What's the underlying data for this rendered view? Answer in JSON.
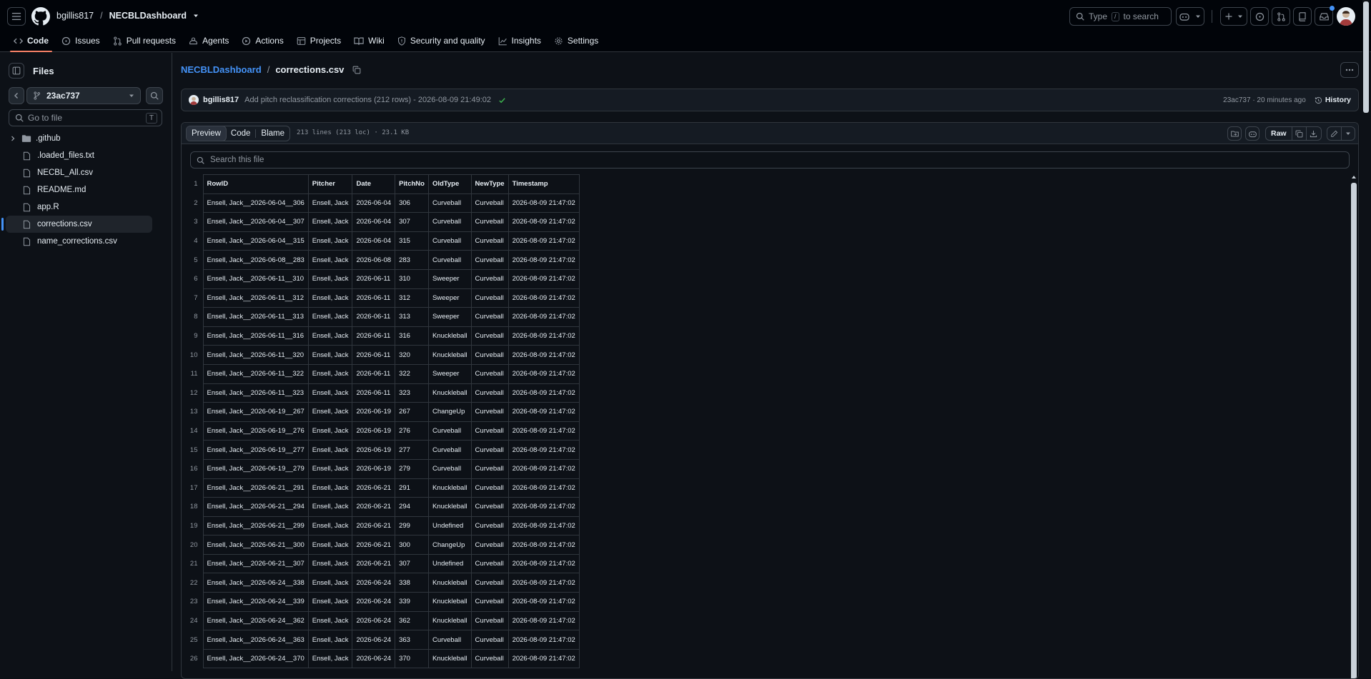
{
  "header": {
    "owner": "bgillis817",
    "separator": "/",
    "repo": "NECBLDashboard",
    "search": {
      "prefix": "Type",
      "key": "/",
      "suffix": "to search"
    }
  },
  "nav": {
    "tabs": [
      {
        "label": "Code",
        "icon": "code-icon"
      },
      {
        "label": "Issues",
        "icon": "issue-icon"
      },
      {
        "label": "Pull requests",
        "icon": "pull-request-icon"
      },
      {
        "label": "Agents",
        "icon": "agent-icon"
      },
      {
        "label": "Actions",
        "icon": "play-icon"
      },
      {
        "label": "Projects",
        "icon": "table-icon"
      },
      {
        "label": "Wiki",
        "icon": "book-icon"
      },
      {
        "label": "Security and quality",
        "icon": "shield-icon"
      },
      {
        "label": "Insights",
        "icon": "graph-icon"
      },
      {
        "label": "Settings",
        "icon": "gear-icon"
      }
    ]
  },
  "sidebar": {
    "title": "Files",
    "branch": "23ac737",
    "goto_placeholder": "Go to file",
    "goto_key": "T",
    "items": [
      {
        "label": ".github",
        "type": "folder"
      },
      {
        "label": ".loaded_files.txt",
        "type": "file"
      },
      {
        "label": "NECBL_All.csv",
        "type": "file"
      },
      {
        "label": "README.md",
        "type": "file"
      },
      {
        "label": "app.R",
        "type": "file"
      },
      {
        "label": "corrections.csv",
        "type": "file",
        "selected": true
      },
      {
        "label": "name_corrections.csv",
        "type": "file"
      }
    ]
  },
  "file": {
    "repo_link": "NECBLDashboard",
    "separator": "/",
    "name": "corrections.csv",
    "commit": {
      "author": "bgillis817",
      "message": "Add pitch reclassification corrections (212 rows) - 2026-08-09 21:49:02",
      "sha_time": "23ac737 · 20 minutes ago",
      "history_label": "History"
    },
    "view_tabs": [
      "Preview",
      "Code",
      "Blame"
    ],
    "meta": "213 lines (213 loc) · 23.1 KB",
    "raw_label": "Raw",
    "search_placeholder": "Search this file"
  },
  "table": {
    "columns": [
      "RowID",
      "Pitcher",
      "Date",
      "PitchNo",
      "OldType",
      "NewType",
      "Timestamp"
    ],
    "rows": [
      [
        "Ensell, Jack__2026-06-04__306",
        "Ensell, Jack",
        "2026-06-04",
        "306",
        "Curveball",
        "Curveball",
        "2026-08-09 21:47:02"
      ],
      [
        "Ensell, Jack__2026-06-04__307",
        "Ensell, Jack",
        "2026-06-04",
        "307",
        "Curveball",
        "Curveball",
        "2026-08-09 21:47:02"
      ],
      [
        "Ensell, Jack__2026-06-04__315",
        "Ensell, Jack",
        "2026-06-04",
        "315",
        "Curveball",
        "Curveball",
        "2026-08-09 21:47:02"
      ],
      [
        "Ensell, Jack__2026-06-08__283",
        "Ensell, Jack",
        "2026-06-08",
        "283",
        "Curveball",
        "Curveball",
        "2026-08-09 21:47:02"
      ],
      [
        "Ensell, Jack__2026-06-11__310",
        "Ensell, Jack",
        "2026-06-11",
        "310",
        "Sweeper",
        "Curveball",
        "2026-08-09 21:47:02"
      ],
      [
        "Ensell, Jack__2026-06-11__312",
        "Ensell, Jack",
        "2026-06-11",
        "312",
        "Sweeper",
        "Curveball",
        "2026-08-09 21:47:02"
      ],
      [
        "Ensell, Jack__2026-06-11__313",
        "Ensell, Jack",
        "2026-06-11",
        "313",
        "Sweeper",
        "Curveball",
        "2026-08-09 21:47:02"
      ],
      [
        "Ensell, Jack__2026-06-11__316",
        "Ensell, Jack",
        "2026-06-11",
        "316",
        "Knuckleball",
        "Curveball",
        "2026-08-09 21:47:02"
      ],
      [
        "Ensell, Jack__2026-06-11__320",
        "Ensell, Jack",
        "2026-06-11",
        "320",
        "Knuckleball",
        "Curveball",
        "2026-08-09 21:47:02"
      ],
      [
        "Ensell, Jack__2026-06-11__322",
        "Ensell, Jack",
        "2026-06-11",
        "322",
        "Sweeper",
        "Curveball",
        "2026-08-09 21:47:02"
      ],
      [
        "Ensell, Jack__2026-06-11__323",
        "Ensell, Jack",
        "2026-06-11",
        "323",
        "Knuckleball",
        "Curveball",
        "2026-08-09 21:47:02"
      ],
      [
        "Ensell, Jack__2026-06-19__267",
        "Ensell, Jack",
        "2026-06-19",
        "267",
        "ChangeUp",
        "Curveball",
        "2026-08-09 21:47:02"
      ],
      [
        "Ensell, Jack__2026-06-19__276",
        "Ensell, Jack",
        "2026-06-19",
        "276",
        "Curveball",
        "Curveball",
        "2026-08-09 21:47:02"
      ],
      [
        "Ensell, Jack__2026-06-19__277",
        "Ensell, Jack",
        "2026-06-19",
        "277",
        "Curveball",
        "Curveball",
        "2026-08-09 21:47:02"
      ],
      [
        "Ensell, Jack__2026-06-19__279",
        "Ensell, Jack",
        "2026-06-19",
        "279",
        "Curveball",
        "Curveball",
        "2026-08-09 21:47:02"
      ],
      [
        "Ensell, Jack__2026-06-21__291",
        "Ensell, Jack",
        "2026-06-21",
        "291",
        "Knuckleball",
        "Curveball",
        "2026-08-09 21:47:02"
      ],
      [
        "Ensell, Jack__2026-06-21__294",
        "Ensell, Jack",
        "2026-06-21",
        "294",
        "Knuckleball",
        "Curveball",
        "2026-08-09 21:47:02"
      ],
      [
        "Ensell, Jack__2026-06-21__299",
        "Ensell, Jack",
        "2026-06-21",
        "299",
        "Undefined",
        "Curveball",
        "2026-08-09 21:47:02"
      ],
      [
        "Ensell, Jack__2026-06-21__300",
        "Ensell, Jack",
        "2026-06-21",
        "300",
        "ChangeUp",
        "Curveball",
        "2026-08-09 21:47:02"
      ],
      [
        "Ensell, Jack__2026-06-21__307",
        "Ensell, Jack",
        "2026-06-21",
        "307",
        "Undefined",
        "Curveball",
        "2026-08-09 21:47:02"
      ],
      [
        "Ensell, Jack__2026-06-24__338",
        "Ensell, Jack",
        "2026-06-24",
        "338",
        "Knuckleball",
        "Curveball",
        "2026-08-09 21:47:02"
      ],
      [
        "Ensell, Jack__2026-06-24__339",
        "Ensell, Jack",
        "2026-06-24",
        "339",
        "Knuckleball",
        "Curveball",
        "2026-08-09 21:47:02"
      ],
      [
        "Ensell, Jack__2026-06-24__362",
        "Ensell, Jack",
        "2026-06-24",
        "362",
        "Knuckleball",
        "Curveball",
        "2026-08-09 21:47:02"
      ],
      [
        "Ensell, Jack__2026-06-24__363",
        "Ensell, Jack",
        "2026-06-24",
        "363",
        "Curveball",
        "Curveball",
        "2026-08-09 21:47:02"
      ],
      [
        "Ensell, Jack__2026-06-24__370",
        "Ensell, Jack",
        "2026-06-24",
        "370",
        "Knuckleball",
        "Curveball",
        "2026-08-09 21:47:02"
      ]
    ]
  },
  "colors": {
    "accent": "#4493f8",
    "tab_underline": "#f78166",
    "success": "#3fb950",
    "background": "#0d1117"
  }
}
